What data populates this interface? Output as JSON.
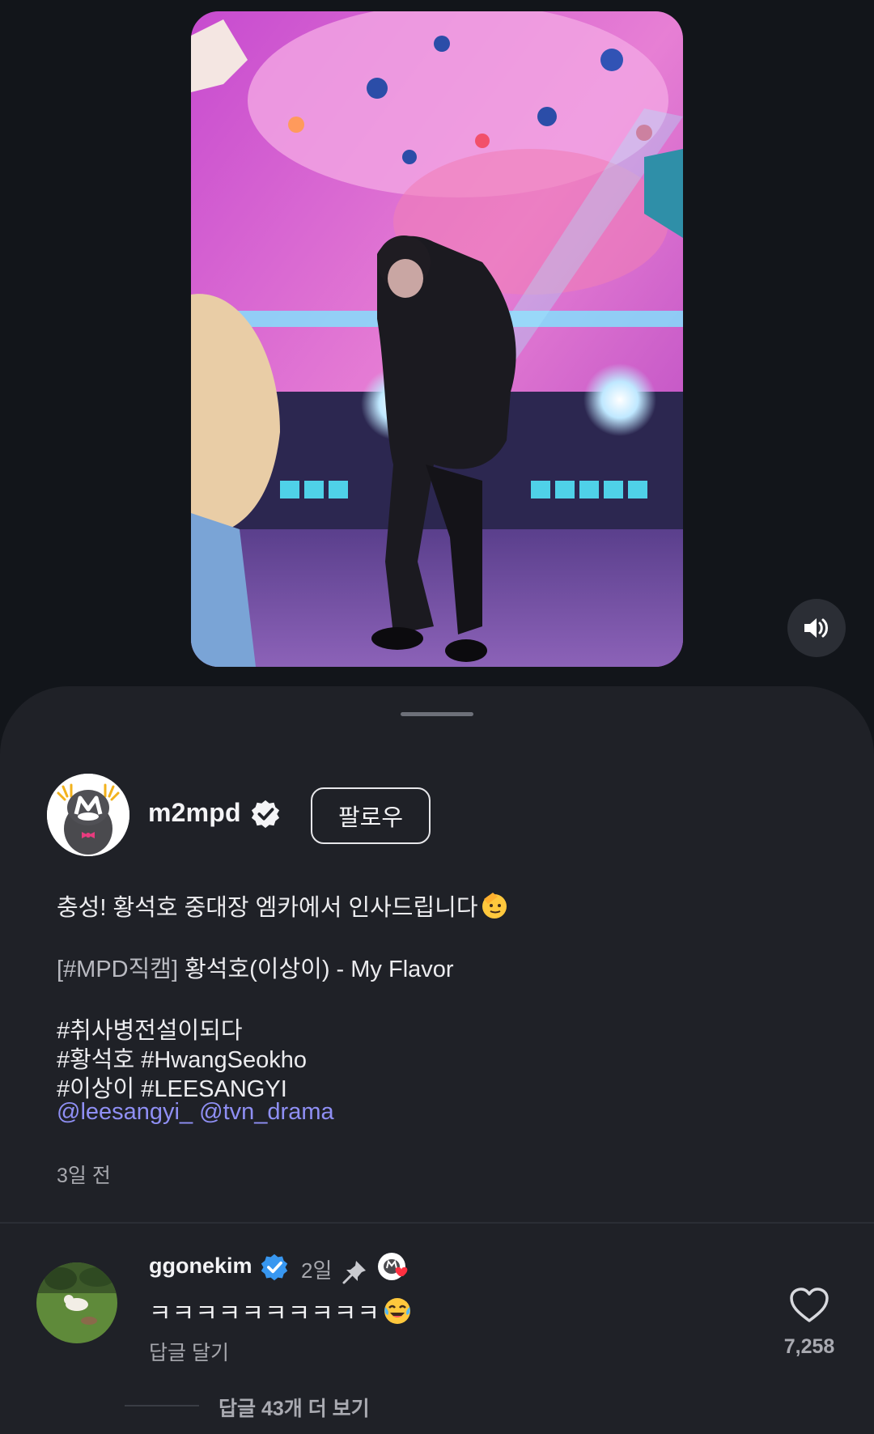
{
  "video": {
    "sound_icon": "speaker-on-icon"
  },
  "post": {
    "username": "m2mpd",
    "follow_label": "팔로우",
    "caption_line1": "충성! 황석호 중대장 엠카에서 인사드립니다",
    "caption_line2_tag": "[#MPD직캠]",
    "caption_line2_rest": " 황석호(이상이) - My Flavor",
    "hashtags_line1": "#취사병전설이되다",
    "hashtags_line2": "#황석호 #HwangSeokho",
    "hashtags_line3": "#이상이 #LEESANGYI",
    "mentions": "@leesangyi_ @tvn_drama",
    "time_ago": "3일 전"
  },
  "comment": {
    "username": "ggonekim",
    "time": "2일",
    "text": "ㅋㅋㅋㅋㅋㅋㅋㅋㅋㅋ",
    "reply_label": "답글 달기",
    "like_count": "7,258",
    "more_replies": "답글 43개 더 보기"
  },
  "colors": {
    "background": "#12151a",
    "sheet": "#1f2127",
    "mention": "#8f8ff4",
    "verified": "#3897f0"
  }
}
